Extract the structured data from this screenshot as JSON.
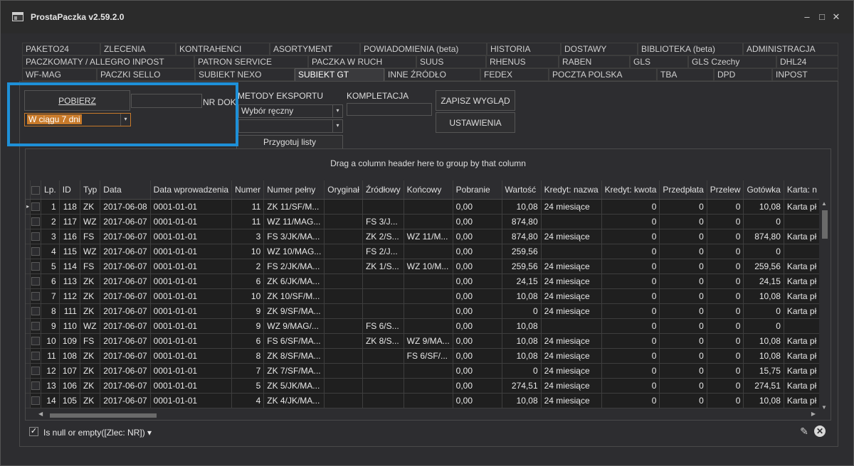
{
  "window": {
    "title": "ProstaPaczka v2.59.2.0"
  },
  "tabs": {
    "row1": [
      "PAKETO24",
      "ZLECENIA",
      "KONTRAHENCI",
      "ASORTYMENT",
      "POWIADOMIENIA (beta)",
      "HISTORIA",
      "DOSTAWY",
      "BIBLIOTEKA (beta)",
      "ADMINISTRACJA"
    ],
    "row2": [
      "PACZKOMATY / ALLEGRO INPOST",
      "PATRON SERVICE",
      "PACZKA W RUCH",
      "SUUS",
      "RHENUS",
      "RABEN",
      "GLS",
      "GLS Czechy",
      "DHL24"
    ],
    "row3": [
      "WF-MAG",
      "PACZKI SELLO",
      "SUBIEKT NEXO",
      "SUBIEKT GT",
      "INNE ŹRÓDŁO",
      "FEDEX",
      "POCZTA POLSKA",
      "TBA",
      "DPD",
      "INPOST"
    ],
    "active": "SUBIEKT GT"
  },
  "toolbar": {
    "pobierz": "POBIERZ",
    "nr_dok_label": "NR DOK",
    "nr_dok_value": "",
    "period": "W ciągu 7 dni",
    "metody_label": "METODY EKSPORTU",
    "metoda1": "Wybór ręczny",
    "metoda2": "",
    "kompletacja_label": "KOMPLETACJA",
    "kompletacja_value": "",
    "zapisz": "ZAPISZ WYGLĄD",
    "ustawienia": "USTAWIENIA",
    "przygotuj": "Przygotuj listy"
  },
  "grid": {
    "group_hint": "Drag a column header here to group by that column",
    "columns": [
      "Lp.",
      "ID",
      "Typ",
      "Data",
      "Data wprowadzenia",
      "Numer",
      "Numer pełny",
      "Oryginał",
      "Źródłowy",
      "Końcowy",
      "Pobranie",
      "Wartość",
      "Kredyt: nazwa",
      "Kredyt: kwota",
      "Przedpłata",
      "Przelew",
      "Gotówka",
      "Karta: n"
    ],
    "rows": [
      [
        "1",
        "118",
        "ZK",
        "2017-06-08",
        "0001-01-01",
        "11",
        "ZK 11/SF/M...",
        "",
        "",
        "",
        "0,00",
        "10,08",
        "24 miesiące",
        "0",
        "0",
        "0",
        "10,08",
        "Karta pł"
      ],
      [
        "2",
        "117",
        "WZ",
        "2017-06-07",
        "0001-01-01",
        "11",
        "WZ 11/MAG...",
        "",
        "FS 3/J...",
        "",
        "0,00",
        "874,80",
        "",
        "0",
        "0",
        "0",
        "0",
        ""
      ],
      [
        "3",
        "116",
        "FS",
        "2017-06-07",
        "0001-01-01",
        "3",
        "FS 3/JK/MA...",
        "",
        "ZK 2/S...",
        "WZ 11/M...",
        "0,00",
        "874,80",
        "24 miesiące",
        "0",
        "0",
        "0",
        "874,80",
        "Karta pł"
      ],
      [
        "4",
        "115",
        "WZ",
        "2017-06-07",
        "0001-01-01",
        "10",
        "WZ 10/MAG...",
        "",
        "FS 2/J...",
        "",
        "0,00",
        "259,56",
        "",
        "0",
        "0",
        "0",
        "0",
        ""
      ],
      [
        "5",
        "114",
        "FS",
        "2017-06-07",
        "0001-01-01",
        "2",
        "FS 2/JK/MA...",
        "",
        "ZK 1/S...",
        "WZ 10/M...",
        "0,00",
        "259,56",
        "24 miesiące",
        "0",
        "0",
        "0",
        "259,56",
        "Karta pł"
      ],
      [
        "6",
        "113",
        "ZK",
        "2017-06-07",
        "0001-01-01",
        "6",
        "ZK 6/JK/MA...",
        "",
        "",
        "",
        "0,00",
        "24,15",
        "24 miesiące",
        "0",
        "0",
        "0",
        "24,15",
        "Karta pł"
      ],
      [
        "7",
        "112",
        "ZK",
        "2017-06-07",
        "0001-01-01",
        "10",
        "ZK 10/SF/M...",
        "",
        "",
        "",
        "0,00",
        "10,08",
        "24 miesiące",
        "0",
        "0",
        "0",
        "10,08",
        "Karta pł"
      ],
      [
        "8",
        "111",
        "ZK",
        "2017-06-07",
        "0001-01-01",
        "9",
        "ZK 9/SF/MA...",
        "",
        "",
        "",
        "0,00",
        "0",
        "24 miesiące",
        "0",
        "0",
        "0",
        "0",
        "Karta pł"
      ],
      [
        "9",
        "110",
        "WZ",
        "2017-06-07",
        "0001-01-01",
        "9",
        "WZ 9/MAG/...",
        "",
        "FS 6/S...",
        "",
        "0,00",
        "10,08",
        "",
        "0",
        "0",
        "0",
        "0",
        ""
      ],
      [
        "10",
        "109",
        "FS",
        "2017-06-07",
        "0001-01-01",
        "6",
        "FS 6/SF/MA...",
        "",
        "ZK 8/S...",
        "WZ 9/MA...",
        "0,00",
        "10,08",
        "24 miesiące",
        "0",
        "0",
        "0",
        "10,08",
        "Karta pł"
      ],
      [
        "11",
        "108",
        "ZK",
        "2017-06-07",
        "0001-01-01",
        "8",
        "ZK 8/SF/MA...",
        "",
        "",
        "FS 6/SF/...",
        "0,00",
        "10,08",
        "24 miesiące",
        "0",
        "0",
        "0",
        "10,08",
        "Karta pł"
      ],
      [
        "12",
        "107",
        "ZK",
        "2017-06-07",
        "0001-01-01",
        "7",
        "ZK 7/SF/MA...",
        "",
        "",
        "",
        "0,00",
        "0",
        "24 miesiące",
        "0",
        "0",
        "0",
        "15,75",
        "Karta pł"
      ],
      [
        "13",
        "106",
        "ZK",
        "2017-06-07",
        "0001-01-01",
        "5",
        "ZK 5/JK/MA...",
        "",
        "",
        "",
        "0,00",
        "274,51",
        "24 miesiące",
        "0",
        "0",
        "0",
        "274,51",
        "Karta pł"
      ],
      [
        "14",
        "105",
        "ZK",
        "2017-06-07",
        "0001-01-01",
        "4",
        "ZK 4/JK/MA...",
        "",
        "",
        "",
        "0,00",
        "10,08",
        "24 miesiące",
        "0",
        "0",
        "0",
        "10,08",
        "Karta pł"
      ]
    ]
  },
  "filter": {
    "text": "Is null or empty([Zlec: NR])"
  },
  "icons": {
    "minimize": "minimize-icon",
    "maximize": "maximize-icon",
    "close": "close-icon",
    "edit": "pencil-icon",
    "clear": "clear-filter-icon"
  },
  "colors": {
    "highlight": "#1e90d8",
    "background": "#2d2d30",
    "row": "#1f1f1f",
    "combo_selected": "#c87a2a"
  }
}
